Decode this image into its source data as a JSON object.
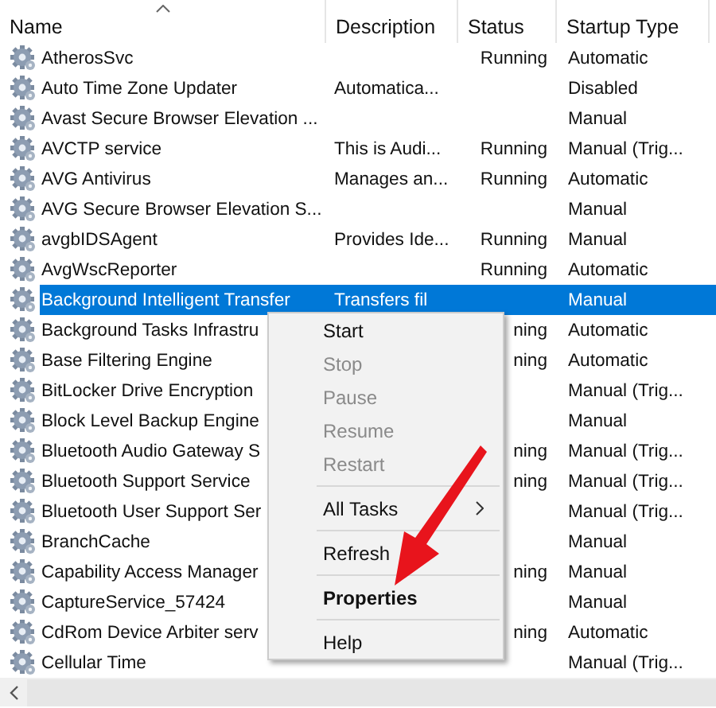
{
  "table": {
    "columns": [
      {
        "label": "Name",
        "sorted": true
      },
      {
        "label": "Description",
        "sorted": false
      },
      {
        "label": "Status",
        "sorted": false
      },
      {
        "label": "Startup Type",
        "sorted": false
      }
    ],
    "rows": [
      {
        "name": "AtherosSvc",
        "description": "",
        "status": "Running",
        "startup_type": "Automatic",
        "selected": false
      },
      {
        "name": "Auto Time Zone Updater",
        "description": "Automatica...",
        "status": "",
        "startup_type": "Disabled",
        "selected": false
      },
      {
        "name": "Avast Secure Browser Elevation ...",
        "description": "",
        "status": "",
        "startup_type": "Manual",
        "selected": false
      },
      {
        "name": "AVCTP service",
        "description": "This is Audi...",
        "status": "Running",
        "startup_type": "Manual (Trig...",
        "selected": false
      },
      {
        "name": "AVG Antivirus",
        "description": "Manages an...",
        "status": "Running",
        "startup_type": "Automatic",
        "selected": false
      },
      {
        "name": "AVG Secure Browser Elevation S...",
        "description": "",
        "status": "",
        "startup_type": "Manual",
        "selected": false
      },
      {
        "name": "avgbIDSAgent",
        "description": "Provides Ide...",
        "status": "Running",
        "startup_type": "Manual",
        "selected": false
      },
      {
        "name": "AvgWscReporter",
        "description": "",
        "status": "Running",
        "startup_type": "Automatic",
        "selected": false
      },
      {
        "name": "Background Intelligent Transfer",
        "description": "Transfers fil",
        "status": "",
        "startup_type": "Manual",
        "selected": true
      },
      {
        "name": "Background Tasks Infrastru",
        "description": "",
        "status": "ning",
        "startup_type": "Automatic",
        "selected": false
      },
      {
        "name": "Base Filtering Engine",
        "description": "",
        "status": "ning",
        "startup_type": "Automatic",
        "selected": false
      },
      {
        "name": "BitLocker Drive Encryption",
        "description": "",
        "status": "",
        "startup_type": "Manual (Trig...",
        "selected": false
      },
      {
        "name": "Block Level Backup Engine",
        "description": "",
        "status": "",
        "startup_type": "Manual",
        "selected": false
      },
      {
        "name": "Bluetooth Audio Gateway S",
        "description": "",
        "status": "ning",
        "startup_type": "Manual (Trig...",
        "selected": false
      },
      {
        "name": "Bluetooth Support Service",
        "description": "",
        "status": "ning",
        "startup_type": "Manual (Trig...",
        "selected": false
      },
      {
        "name": "Bluetooth User Support Ser",
        "description": "",
        "status": "",
        "startup_type": "Manual (Trig...",
        "selected": false
      },
      {
        "name": "BranchCache",
        "description": "",
        "status": "",
        "startup_type": "Manual",
        "selected": false
      },
      {
        "name": "Capability Access Manager",
        "description": "",
        "status": "ning",
        "startup_type": "Manual",
        "selected": false
      },
      {
        "name": "CaptureService_57424",
        "description": "",
        "status": "",
        "startup_type": "Manual",
        "selected": false
      },
      {
        "name": "CdRom Device Arbiter serv",
        "description": "",
        "status": "ning",
        "startup_type": "Automatic",
        "selected": false
      },
      {
        "name": "Cellular Time",
        "description": "",
        "status": "",
        "startup_type": "Manual (Trig...",
        "selected": false
      }
    ]
  },
  "context_menu": {
    "items": [
      {
        "kind": "item",
        "label": "Start",
        "disabled": false,
        "default": false,
        "submenu": false
      },
      {
        "kind": "item",
        "label": "Stop",
        "disabled": true,
        "default": false,
        "submenu": false
      },
      {
        "kind": "item",
        "label": "Pause",
        "disabled": true,
        "default": false,
        "submenu": false
      },
      {
        "kind": "item",
        "label": "Resume",
        "disabled": true,
        "default": false,
        "submenu": false
      },
      {
        "kind": "item",
        "label": "Restart",
        "disabled": true,
        "default": false,
        "submenu": false
      },
      {
        "kind": "separator"
      },
      {
        "kind": "item",
        "label": "All Tasks",
        "disabled": false,
        "default": false,
        "submenu": true
      },
      {
        "kind": "separator"
      },
      {
        "kind": "item",
        "label": "Refresh",
        "disabled": false,
        "default": false,
        "submenu": false
      },
      {
        "kind": "separator"
      },
      {
        "kind": "item",
        "label": "Properties",
        "disabled": false,
        "default": true,
        "submenu": false
      },
      {
        "kind": "separator"
      },
      {
        "kind": "item",
        "label": "Help",
        "disabled": false,
        "default": false,
        "submenu": false
      }
    ]
  }
}
